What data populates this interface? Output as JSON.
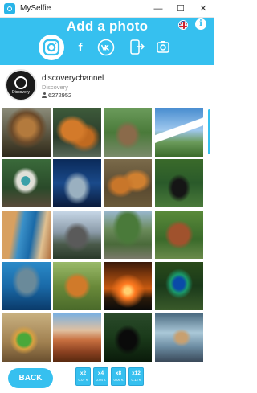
{
  "window": {
    "title": "MySelfie",
    "minimize": "—",
    "maximize": "☐",
    "close": "✕"
  },
  "header": {
    "title": "Add a photo",
    "info_glyph": "i",
    "facebook_glyph": "f"
  },
  "profile": {
    "username": "discoverychannel",
    "subtitle": "Discovery",
    "followers": "6272952",
    "avatar_brand": "Discovery"
  },
  "photos": [
    {
      "subject": "lion"
    },
    {
      "subject": "tigers"
    },
    {
      "subject": "bears"
    },
    {
      "subject": "mountain"
    },
    {
      "subject": "bird"
    },
    {
      "subject": "underwater"
    },
    {
      "subject": "tiger-cubs"
    },
    {
      "subject": "bear-forest"
    },
    {
      "subject": "aerial-coast"
    },
    {
      "subject": "rock-peak"
    },
    {
      "subject": "ruins"
    },
    {
      "subject": "highland-cow"
    },
    {
      "subject": "divers"
    },
    {
      "subject": "tiger-grass"
    },
    {
      "subject": "sunset"
    },
    {
      "subject": "peacock"
    },
    {
      "subject": "lizard"
    },
    {
      "subject": "canyon"
    },
    {
      "subject": "panther"
    },
    {
      "subject": "ice-cave"
    }
  ],
  "footer": {
    "back_label": "BACK",
    "packs": [
      {
        "mult": "x2",
        "price": "0.07 €"
      },
      {
        "mult": "x4",
        "price": "0.04 €"
      },
      {
        "mult": "x8",
        "price": "0.06 €"
      },
      {
        "mult": "x12",
        "price": "0.12 €"
      }
    ]
  },
  "colors": {
    "accent": "#36c0ef"
  }
}
